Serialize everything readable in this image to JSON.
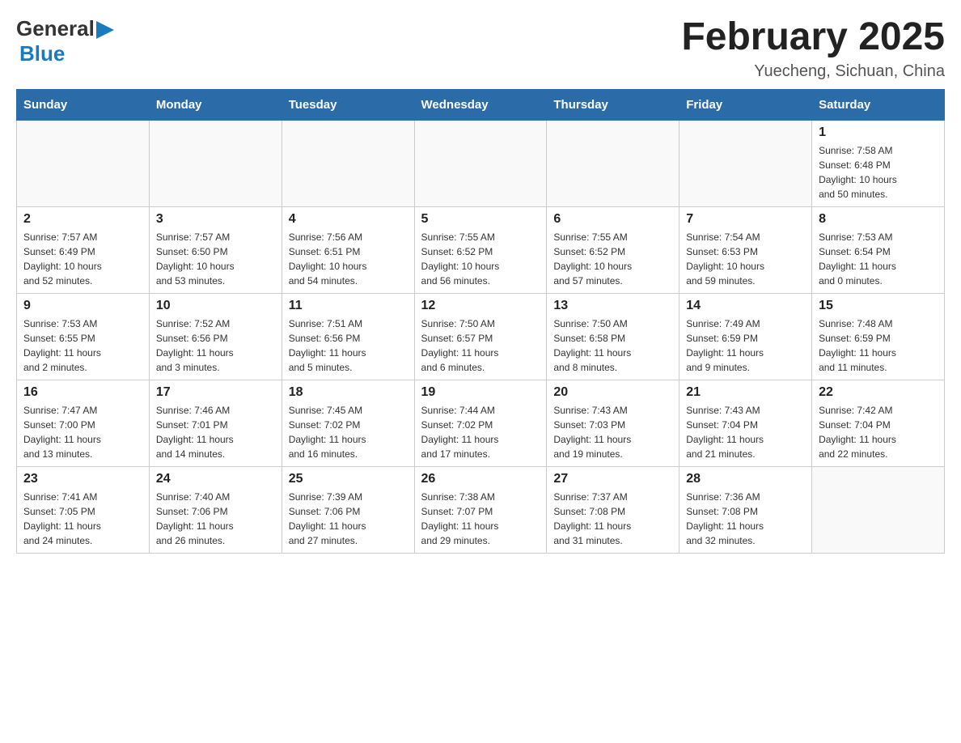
{
  "header": {
    "logo": {
      "text_general": "General",
      "text_blue": "Blue",
      "aria": "GeneralBlue logo"
    },
    "title": "February 2025",
    "location": "Yuecheng, Sichuan, China"
  },
  "weekdays": [
    "Sunday",
    "Monday",
    "Tuesday",
    "Wednesday",
    "Thursday",
    "Friday",
    "Saturday"
  ],
  "weeks": [
    [
      {
        "day": "",
        "info": ""
      },
      {
        "day": "",
        "info": ""
      },
      {
        "day": "",
        "info": ""
      },
      {
        "day": "",
        "info": ""
      },
      {
        "day": "",
        "info": ""
      },
      {
        "day": "",
        "info": ""
      },
      {
        "day": "1",
        "info": "Sunrise: 7:58 AM\nSunset: 6:48 PM\nDaylight: 10 hours\nand 50 minutes."
      }
    ],
    [
      {
        "day": "2",
        "info": "Sunrise: 7:57 AM\nSunset: 6:49 PM\nDaylight: 10 hours\nand 52 minutes."
      },
      {
        "day": "3",
        "info": "Sunrise: 7:57 AM\nSunset: 6:50 PM\nDaylight: 10 hours\nand 53 minutes."
      },
      {
        "day": "4",
        "info": "Sunrise: 7:56 AM\nSunset: 6:51 PM\nDaylight: 10 hours\nand 54 minutes."
      },
      {
        "day": "5",
        "info": "Sunrise: 7:55 AM\nSunset: 6:52 PM\nDaylight: 10 hours\nand 56 minutes."
      },
      {
        "day": "6",
        "info": "Sunrise: 7:55 AM\nSunset: 6:52 PM\nDaylight: 10 hours\nand 57 minutes."
      },
      {
        "day": "7",
        "info": "Sunrise: 7:54 AM\nSunset: 6:53 PM\nDaylight: 10 hours\nand 59 minutes."
      },
      {
        "day": "8",
        "info": "Sunrise: 7:53 AM\nSunset: 6:54 PM\nDaylight: 11 hours\nand 0 minutes."
      }
    ],
    [
      {
        "day": "9",
        "info": "Sunrise: 7:53 AM\nSunset: 6:55 PM\nDaylight: 11 hours\nand 2 minutes."
      },
      {
        "day": "10",
        "info": "Sunrise: 7:52 AM\nSunset: 6:56 PM\nDaylight: 11 hours\nand 3 minutes."
      },
      {
        "day": "11",
        "info": "Sunrise: 7:51 AM\nSunset: 6:56 PM\nDaylight: 11 hours\nand 5 minutes."
      },
      {
        "day": "12",
        "info": "Sunrise: 7:50 AM\nSunset: 6:57 PM\nDaylight: 11 hours\nand 6 minutes."
      },
      {
        "day": "13",
        "info": "Sunrise: 7:50 AM\nSunset: 6:58 PM\nDaylight: 11 hours\nand 8 minutes."
      },
      {
        "day": "14",
        "info": "Sunrise: 7:49 AM\nSunset: 6:59 PM\nDaylight: 11 hours\nand 9 minutes."
      },
      {
        "day": "15",
        "info": "Sunrise: 7:48 AM\nSunset: 6:59 PM\nDaylight: 11 hours\nand 11 minutes."
      }
    ],
    [
      {
        "day": "16",
        "info": "Sunrise: 7:47 AM\nSunset: 7:00 PM\nDaylight: 11 hours\nand 13 minutes."
      },
      {
        "day": "17",
        "info": "Sunrise: 7:46 AM\nSunset: 7:01 PM\nDaylight: 11 hours\nand 14 minutes."
      },
      {
        "day": "18",
        "info": "Sunrise: 7:45 AM\nSunset: 7:02 PM\nDaylight: 11 hours\nand 16 minutes."
      },
      {
        "day": "19",
        "info": "Sunrise: 7:44 AM\nSunset: 7:02 PM\nDaylight: 11 hours\nand 17 minutes."
      },
      {
        "day": "20",
        "info": "Sunrise: 7:43 AM\nSunset: 7:03 PM\nDaylight: 11 hours\nand 19 minutes."
      },
      {
        "day": "21",
        "info": "Sunrise: 7:43 AM\nSunset: 7:04 PM\nDaylight: 11 hours\nand 21 minutes."
      },
      {
        "day": "22",
        "info": "Sunrise: 7:42 AM\nSunset: 7:04 PM\nDaylight: 11 hours\nand 22 minutes."
      }
    ],
    [
      {
        "day": "23",
        "info": "Sunrise: 7:41 AM\nSunset: 7:05 PM\nDaylight: 11 hours\nand 24 minutes."
      },
      {
        "day": "24",
        "info": "Sunrise: 7:40 AM\nSunset: 7:06 PM\nDaylight: 11 hours\nand 26 minutes."
      },
      {
        "day": "25",
        "info": "Sunrise: 7:39 AM\nSunset: 7:06 PM\nDaylight: 11 hours\nand 27 minutes."
      },
      {
        "day": "26",
        "info": "Sunrise: 7:38 AM\nSunset: 7:07 PM\nDaylight: 11 hours\nand 29 minutes."
      },
      {
        "day": "27",
        "info": "Sunrise: 7:37 AM\nSunset: 7:08 PM\nDaylight: 11 hours\nand 31 minutes."
      },
      {
        "day": "28",
        "info": "Sunrise: 7:36 AM\nSunset: 7:08 PM\nDaylight: 11 hours\nand 32 minutes."
      },
      {
        "day": "",
        "info": ""
      }
    ]
  ]
}
